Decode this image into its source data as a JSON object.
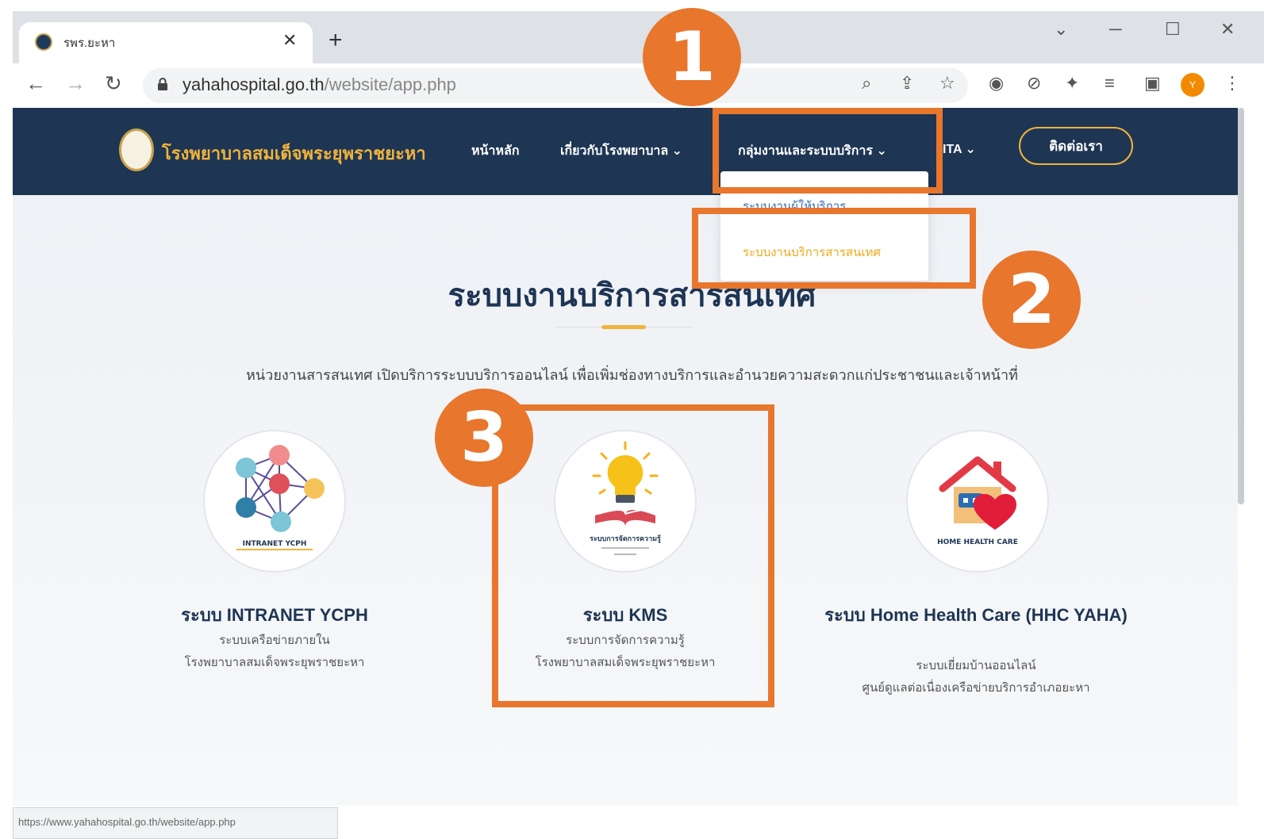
{
  "browser": {
    "tab_title": "รพร.ยะหา",
    "url_host": "yahahospital.go.th",
    "url_path": "/website/app.php",
    "status_url": "https://www.yahahospital.go.th/website/app.php",
    "profile_initial": "Y"
  },
  "site": {
    "name": "โรงพยาบาลสมเด็จพระยุพราชยะหา",
    "nav": {
      "home": "หน้าหลัก",
      "about": "เกี่ยวกับโรงพยาบาล",
      "services": "กลุ่มงานและระบบบริการ",
      "ita": "ITA",
      "contact": "ติดต่อเรา"
    },
    "dropdown": [
      "ระบบงานผู้ให้บริการ",
      "ระบบงานบริการสารสนเทศ"
    ]
  },
  "main": {
    "title": "ระบบงานบริการสารสนเทศ",
    "description": "หน่วยงานสารสนเทศ เปิดบริการระบบบริการออนไลน์ เพื่อเพิ่มช่องทางบริการและอำนวยความสะดวกแก่ประชาชนและเจ้าหน้าที่",
    "cards": [
      {
        "logo_text": "INTRANET YCPH",
        "title": "ระบบ INTRANET YCPH",
        "desc1": "ระบบเครือข่ายภายใน",
        "desc2": "โรงพยาบาลสมเด็จพระยุพราชยะหา"
      },
      {
        "logo_text": "ระบบการจัดการความรู้",
        "title": "ระบบ KMS",
        "desc1": "ระบบการจัดการความรู้",
        "desc2": "โรงพยาบาลสมเด็จพระยุพราชยะหา"
      },
      {
        "logo_text": "HOME HEALTH CARE",
        "title": "ระบบ Home Health Care (HHC YAHA)",
        "desc1": "ระบบเยี่ยมบ้านออนไลน์",
        "desc2": "ศูนย์ดูแลต่อเนื่องเครือข่ายบริการอำเภอยะหา"
      }
    ]
  },
  "annotations": [
    "1",
    "2",
    "3"
  ],
  "colors": {
    "nav_bg": "#1e3554",
    "accent": "#f0b33a",
    "annotation": "#e8762c"
  }
}
